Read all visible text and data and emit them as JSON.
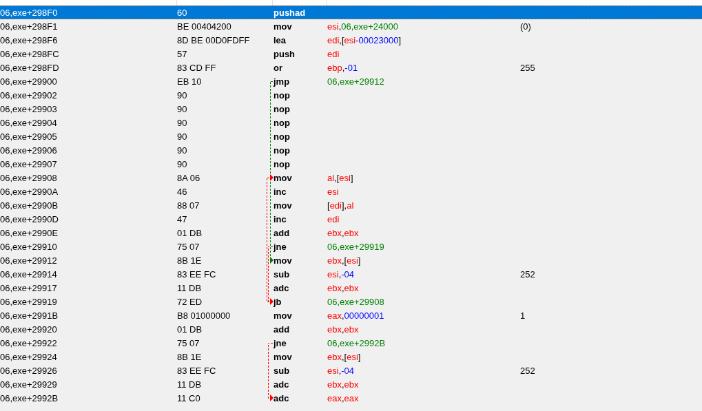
{
  "rows": [
    {
      "address": "06,exe+298F0",
      "bytes": "60",
      "opcode": "pushad",
      "selected": true
    },
    {
      "address": "06,exe+298F1",
      "bytes": "BE 00404200",
      "opcode": "mov",
      "operands": [
        {
          "kind": "reg",
          "text": "esi"
        },
        {
          "kind": "sym",
          "text": ","
        },
        {
          "kind": "addr",
          "text": "06,exe+24000"
        }
      ],
      "comment": "(0)",
      "selected": false
    },
    {
      "address": "06,exe+298F6",
      "bytes": "8D BE 00D0FDFF",
      "opcode": "lea",
      "operands": [
        {
          "kind": "reg",
          "text": "edi"
        },
        {
          "kind": "sym",
          "text": ",["
        },
        {
          "kind": "reg",
          "text": "esi"
        },
        {
          "kind": "num",
          "text": "-00023000"
        },
        {
          "kind": "sym",
          "text": "]"
        }
      ],
      "selected": false
    },
    {
      "address": "06,exe+298FC",
      "bytes": "57",
      "opcode": "push",
      "operands": [
        {
          "kind": "reg",
          "text": "edi"
        }
      ],
      "selected": false
    },
    {
      "address": "06,exe+298FD",
      "bytes": "83 CD FF",
      "opcode": "or",
      "operands": [
        {
          "kind": "reg",
          "text": "ebp"
        },
        {
          "kind": "sym",
          "text": ","
        },
        {
          "kind": "num",
          "text": "-01"
        }
      ],
      "comment": "255",
      "selected": false
    },
    {
      "address": "06,exe+29900",
      "bytes": "EB 10",
      "opcode": "jmp",
      "operands": [
        {
          "kind": "addr",
          "text": "06,exe+29912"
        }
      ],
      "jump": {
        "color": "#008000"
      },
      "selected": false
    },
    {
      "address": "06,exe+29902",
      "bytes": "90",
      "opcode": "nop",
      "selected": false
    },
    {
      "address": "06,exe+29903",
      "bytes": "90",
      "opcode": "nop",
      "selected": false
    },
    {
      "address": "06,exe+29904",
      "bytes": "90",
      "opcode": "nop",
      "selected": false
    },
    {
      "address": "06,exe+29905",
      "bytes": "90",
      "opcode": "nop",
      "selected": false
    },
    {
      "address": "06,exe+29906",
      "bytes": "90",
      "opcode": "nop",
      "selected": false
    },
    {
      "address": "06,exe+29907",
      "bytes": "90",
      "opcode": "nop",
      "selected": false
    },
    {
      "address": "06,exe+29908",
      "bytes": "8A 06",
      "opcode": "mov",
      "operands": [
        {
          "kind": "reg",
          "text": "al"
        },
        {
          "kind": "sym",
          "text": ",["
        },
        {
          "kind": "reg",
          "text": "esi"
        },
        {
          "kind": "sym",
          "text": "]"
        }
      ],
      "selected": false
    },
    {
      "address": "06,exe+2990A",
      "bytes": "46",
      "opcode": "inc",
      "operands": [
        {
          "kind": "reg",
          "text": "esi"
        }
      ],
      "selected": false
    },
    {
      "address": "06,exe+2990B",
      "bytes": "88 07",
      "opcode": "mov",
      "operands": [
        {
          "kind": "sym",
          "text": "["
        },
        {
          "kind": "reg",
          "text": "edi"
        },
        {
          "kind": "sym",
          "text": "],"
        },
        {
          "kind": "reg",
          "text": "al"
        }
      ],
      "selected": false
    },
    {
      "address": "06,exe+2990D",
      "bytes": "47",
      "opcode": "inc",
      "operands": [
        {
          "kind": "reg",
          "text": "edi"
        }
      ],
      "selected": false
    },
    {
      "address": "06,exe+2990E",
      "bytes": "01 DB",
      "opcode": "add",
      "operands": [
        {
          "kind": "reg",
          "text": "ebx"
        },
        {
          "kind": "sym",
          "text": ","
        },
        {
          "kind": "reg",
          "text": "ebx"
        }
      ],
      "selected": false
    },
    {
      "address": "06,exe+29910",
      "bytes": "75 07",
      "opcode": "jne",
      "operands": [
        {
          "kind": "addr",
          "text": "06,exe+29919"
        }
      ],
      "jump": {
        "color": "#ff0000"
      },
      "selected": false
    },
    {
      "address": "06,exe+29912",
      "bytes": "8B 1E",
      "opcode": "mov",
      "operands": [
        {
          "kind": "reg",
          "text": "ebx"
        },
        {
          "kind": "sym",
          "text": ",["
        },
        {
          "kind": "reg",
          "text": "esi"
        },
        {
          "kind": "sym",
          "text": "]"
        }
      ],
      "selected": false
    },
    {
      "address": "06,exe+29914",
      "bytes": "83 EE FC",
      "opcode": "sub",
      "operands": [
        {
          "kind": "reg",
          "text": "esi"
        },
        {
          "kind": "sym",
          "text": ","
        },
        {
          "kind": "num",
          "text": "-04"
        }
      ],
      "comment": "252",
      "selected": false
    },
    {
      "address": "06,exe+29917",
      "bytes": "11 DB",
      "opcode": "adc",
      "operands": [
        {
          "kind": "reg",
          "text": "ebx"
        },
        {
          "kind": "sym",
          "text": ","
        },
        {
          "kind": "reg",
          "text": "ebx"
        }
      ],
      "selected": false
    },
    {
      "address": "06,exe+29919",
      "bytes": "72 ED",
      "opcode": "jb",
      "operands": [
        {
          "kind": "addr",
          "text": "06,exe+29908"
        }
      ],
      "jump": {
        "color": "#ff0000"
      },
      "selected": false
    },
    {
      "address": "06,exe+2991B",
      "bytes": "B8 01000000",
      "opcode": "mov",
      "operands": [
        {
          "kind": "reg",
          "text": "eax"
        },
        {
          "kind": "sym",
          "text": ","
        },
        {
          "kind": "num",
          "text": "00000001"
        }
      ],
      "comment": "1",
      "selected": false
    },
    {
      "address": "06,exe+29920",
      "bytes": "01 DB",
      "opcode": "add",
      "operands": [
        {
          "kind": "reg",
          "text": "ebx"
        },
        {
          "kind": "sym",
          "text": ","
        },
        {
          "kind": "reg",
          "text": "ebx"
        }
      ],
      "selected": false
    },
    {
      "address": "06,exe+29922",
      "bytes": "75 07",
      "opcode": "jne",
      "operands": [
        {
          "kind": "addr",
          "text": "06,exe+2992B"
        }
      ],
      "jump": {
        "color": "#ff0000"
      },
      "selected": false
    },
    {
      "address": "06,exe+29924",
      "bytes": "8B 1E",
      "opcode": "mov",
      "operands": [
        {
          "kind": "reg",
          "text": "ebx"
        },
        {
          "kind": "sym",
          "text": ",["
        },
        {
          "kind": "reg",
          "text": "esi"
        },
        {
          "kind": "sym",
          "text": "]"
        }
      ],
      "selected": false
    },
    {
      "address": "06,exe+29926",
      "bytes": "83 EE FC",
      "opcode": "sub",
      "operands": [
        {
          "kind": "reg",
          "text": "esi"
        },
        {
          "kind": "sym",
          "text": ","
        },
        {
          "kind": "num",
          "text": "-04"
        }
      ],
      "comment": "252",
      "selected": false
    },
    {
      "address": "06,exe+29929",
      "bytes": "11 DB",
      "opcode": "adc",
      "operands": [
        {
          "kind": "reg",
          "text": "ebx"
        },
        {
          "kind": "sym",
          "text": ","
        },
        {
          "kind": "reg",
          "text": "ebx"
        }
      ],
      "selected": false
    },
    {
      "address": "06,exe+2992B",
      "bytes": "11 C0",
      "opcode": "adc",
      "operands": [
        {
          "kind": "reg",
          "text": "eax"
        },
        {
          "kind": "sym",
          "text": ","
        },
        {
          "kind": "reg",
          "text": "eax"
        }
      ],
      "selected": false
    }
  ]
}
